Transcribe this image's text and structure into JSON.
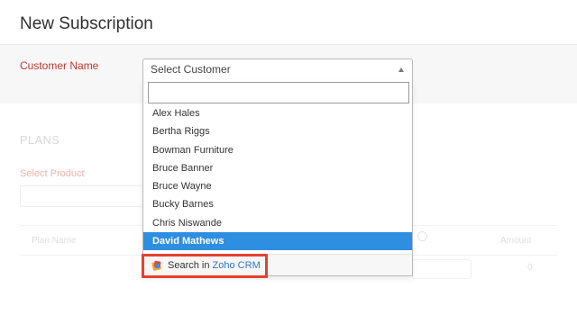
{
  "page": {
    "title": "New Subscription"
  },
  "customer": {
    "label": "Customer Name",
    "select_value": "Select Customer",
    "search_value": ""
  },
  "dropdown": {
    "items": [
      {
        "label": "Alex Hales",
        "selected": false
      },
      {
        "label": "Bertha Riggs",
        "selected": false
      },
      {
        "label": "Bowman Furniture",
        "selected": false
      },
      {
        "label": "Bruce Banner",
        "selected": false
      },
      {
        "label": "Bruce Wayne",
        "selected": false
      },
      {
        "label": "Bucky Barnes",
        "selected": false
      },
      {
        "label": "Chris Niswande",
        "selected": false
      },
      {
        "label": "David Mathews",
        "selected": true
      }
    ],
    "footer": {
      "prefix": "Search in",
      "brand": "Zoho CRM",
      "icon": "zoho-crm-icon"
    }
  },
  "plans": {
    "heading": "PLANS",
    "select_product_label": "Select Product",
    "columns": {
      "plan_name": "Plan Name",
      "amount": "Amount"
    },
    "amount_value": "0"
  },
  "colors": {
    "required_label": "#c2382f",
    "selected_item": "#2e8ee0",
    "highlight": "#e5412f",
    "crm_link": "#2f74c9"
  }
}
